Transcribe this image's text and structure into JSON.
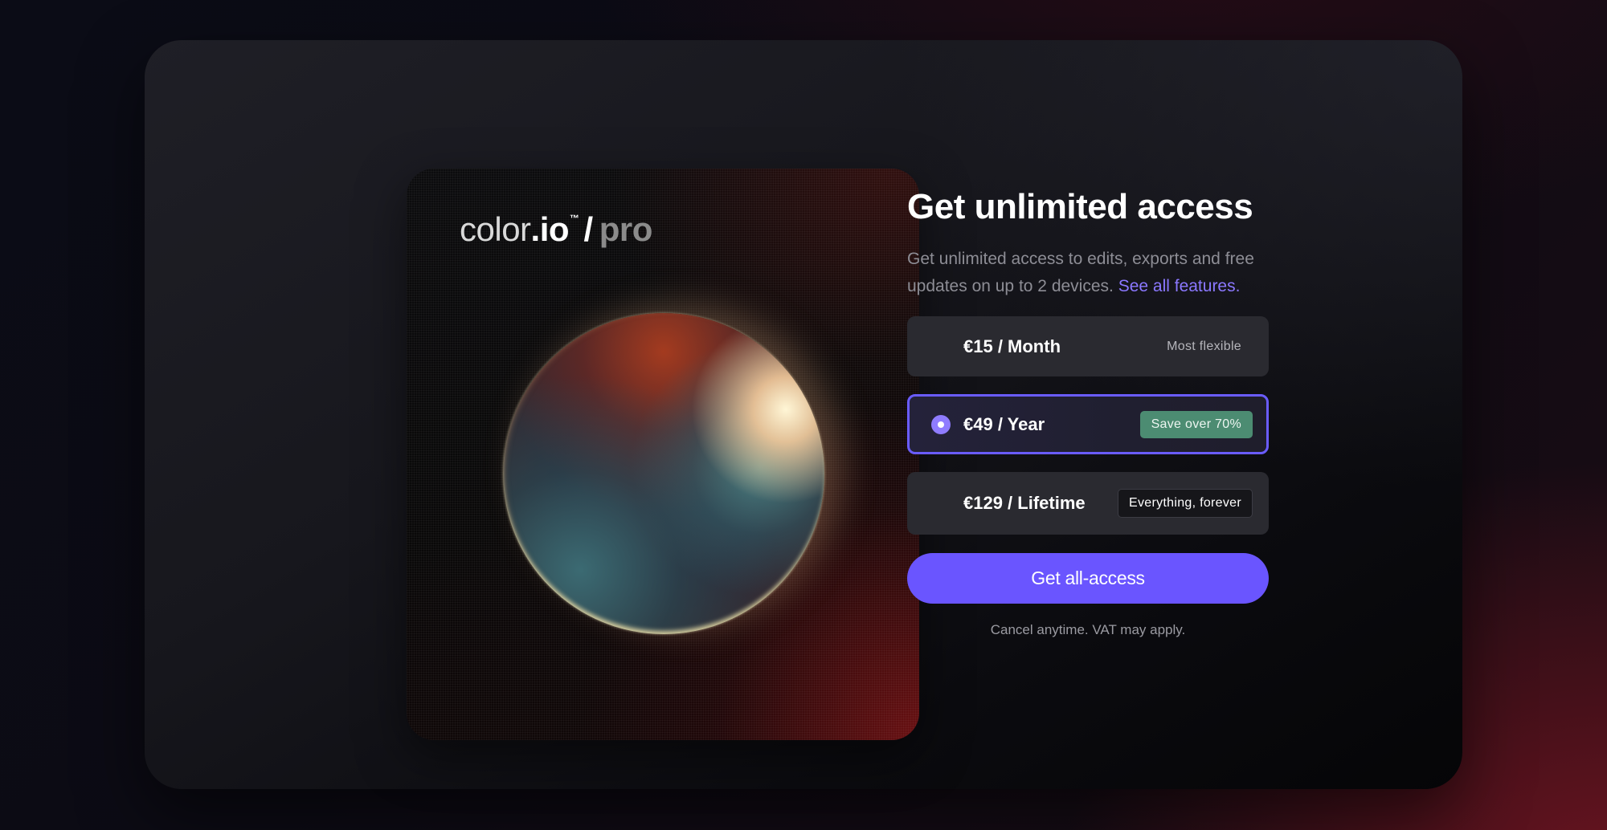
{
  "brand": {
    "name": "color",
    "tld": ".io",
    "trademark": "™",
    "slash": "/",
    "tier": "pro"
  },
  "heading": "Get unlimited access",
  "description": {
    "text": "Get unlimited access to edits, exports and free updates on up to 2 devices. ",
    "link": "See all features."
  },
  "plans": [
    {
      "price": "€15 / Month",
      "tag": "Most flexible",
      "selected": false
    },
    {
      "price": "€49 / Year",
      "tag": "Save over 70%",
      "selected": true
    },
    {
      "price": "€129 / Lifetime",
      "tag": "Everything, forever",
      "selected": false
    }
  ],
  "cta": {
    "label": "Get all-access"
  },
  "footnote": "Cancel anytime. VAT may apply.",
  "colors": {
    "accent": "#6a55ff",
    "link": "#8b78ff",
    "badge_green": "#4c8c72",
    "background": "#0b0c16"
  },
  "icons": [
    "radio-selected-icon"
  ]
}
